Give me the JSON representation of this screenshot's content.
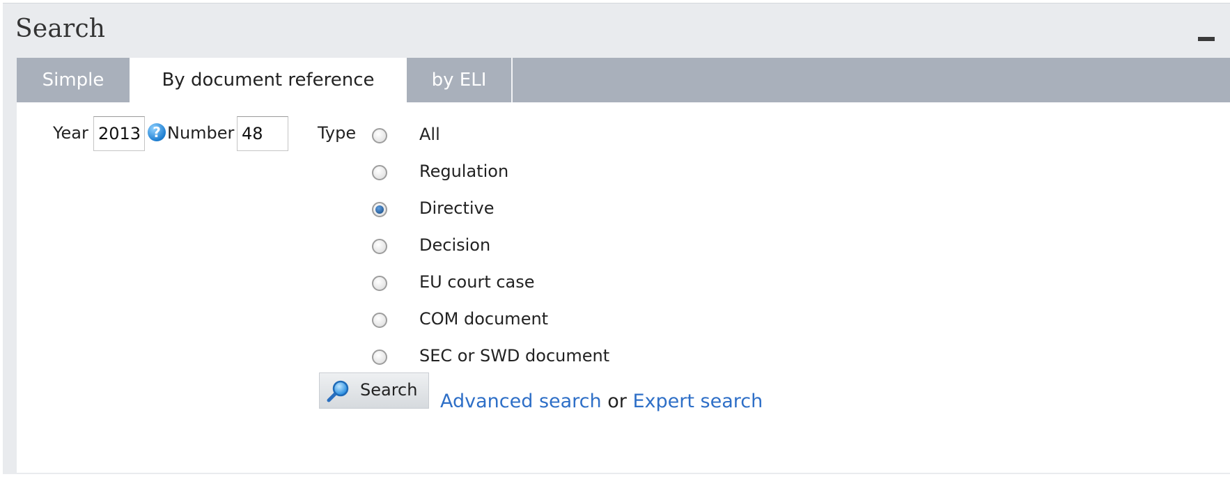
{
  "panel": {
    "title": "Search"
  },
  "tabs": [
    {
      "label": "Simple",
      "active": false
    },
    {
      "label": "By document reference",
      "active": true
    },
    {
      "label": "by ELI",
      "active": false
    }
  ],
  "form": {
    "year_label": "Year",
    "year_value": "2013",
    "number_label": "Number",
    "number_value": "48",
    "help_icon": "?",
    "type_label": "Type",
    "types": [
      {
        "label": "All",
        "checked": false
      },
      {
        "label": "Regulation",
        "checked": false
      },
      {
        "label": "Directive",
        "checked": true
      },
      {
        "label": "Decision",
        "checked": false
      },
      {
        "label": "EU court case",
        "checked": false
      },
      {
        "label": "COM document",
        "checked": false
      },
      {
        "label": "SEC or SWD document",
        "checked": false
      }
    ]
  },
  "actions": {
    "search_label": "Search",
    "advanced_search": "Advanced search",
    "or_text": "or",
    "expert_search": "Expert search"
  },
  "colors": {
    "panel_bg": "#e9ebee",
    "tabbar_bg": "#a9b0bb",
    "link": "#2e6fc7"
  }
}
